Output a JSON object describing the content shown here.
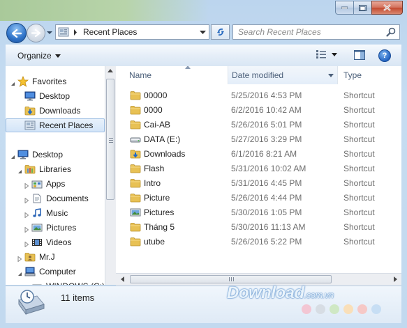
{
  "window": {
    "caption_buttons": [
      "minimize",
      "maximize",
      "close"
    ]
  },
  "address": {
    "path": "Recent Places",
    "search_placeholder": "Search Recent Places"
  },
  "toolbar": {
    "organize_label": "Organize"
  },
  "nav": {
    "items": [
      {
        "label": "Favorites",
        "icon": "star-icon",
        "level": 0,
        "expander": "open"
      },
      {
        "label": "Desktop",
        "icon": "desktop-icon",
        "level": 1
      },
      {
        "label": "Downloads",
        "icon": "downloads-folder-icon",
        "level": 1
      },
      {
        "label": "Recent Places",
        "icon": "recent-places-icon",
        "level": 1,
        "selected": true
      },
      {
        "label": "Desktop",
        "icon": "desktop-icon",
        "level": 0,
        "expander": "open"
      },
      {
        "label": "Libraries",
        "icon": "libraries-icon",
        "level": 1,
        "expander": "open"
      },
      {
        "label": "Apps",
        "icon": "apps-library-icon",
        "level": 2,
        "expander": "closed"
      },
      {
        "label": "Documents",
        "icon": "documents-library-icon",
        "level": 2,
        "expander": "closed"
      },
      {
        "label": "Music",
        "icon": "music-library-icon",
        "level": 2,
        "expander": "closed"
      },
      {
        "label": "Pictures",
        "icon": "pictures-library-icon",
        "level": 2,
        "expander": "closed"
      },
      {
        "label": "Videos",
        "icon": "videos-library-icon",
        "level": 2,
        "expander": "closed"
      },
      {
        "label": "Mr.J",
        "icon": "user-folder-icon",
        "level": 1,
        "expander": "closed"
      },
      {
        "label": "Computer",
        "icon": "computer-icon",
        "level": 1,
        "expander": "open"
      },
      {
        "label": "WINDOWS (C:)",
        "icon": "drive-icon",
        "level": 2,
        "expander": "closed"
      }
    ]
  },
  "columns": {
    "name": "Name",
    "date": "Date modified",
    "type": "Type"
  },
  "files": [
    {
      "name": "00000",
      "date": "5/25/2016 4:53 PM",
      "type": "Shortcut",
      "icon": "folder-icon"
    },
    {
      "name": "0000",
      "date": "6/2/2016 10:42 AM",
      "type": "Shortcut",
      "icon": "folder-icon"
    },
    {
      "name": "Cai-AB",
      "date": "5/26/2016 5:01 PM",
      "type": "Shortcut",
      "icon": "folder-icon"
    },
    {
      "name": "DATA (E:)",
      "date": "5/27/2016 3:29 PM",
      "type": "Shortcut",
      "icon": "drive-icon"
    },
    {
      "name": "Downloads",
      "date": "6/1/2016 8:21 AM",
      "type": "Shortcut",
      "icon": "downloads-folder-icon"
    },
    {
      "name": "Flash",
      "date": "5/31/2016 10:02 AM",
      "type": "Shortcut",
      "icon": "folder-icon"
    },
    {
      "name": "Intro",
      "date": "5/31/2016 4:45 PM",
      "type": "Shortcut",
      "icon": "folder-icon"
    },
    {
      "name": "Picture",
      "date": "5/26/2016 4:44 PM",
      "type": "Shortcut",
      "icon": "folder-icon"
    },
    {
      "name": "Pictures",
      "date": "5/30/2016 1:05 PM",
      "type": "Shortcut",
      "icon": "pictures-library-icon"
    },
    {
      "name": "Tháng 5",
      "date": "5/30/2016 11:13 AM",
      "type": "Shortcut",
      "icon": "folder-icon"
    },
    {
      "name": "utube",
      "date": "5/26/2016 5:22 PM",
      "type": "Shortcut",
      "icon": "folder-icon"
    }
  ],
  "details": {
    "count_text": "11 items"
  },
  "watermark": {
    "brand": "Download",
    "suffix": ".com.vn"
  },
  "colors": {
    "accent": "#3399ff",
    "folder": "#e8c154",
    "selection": "#d3e5f8"
  }
}
